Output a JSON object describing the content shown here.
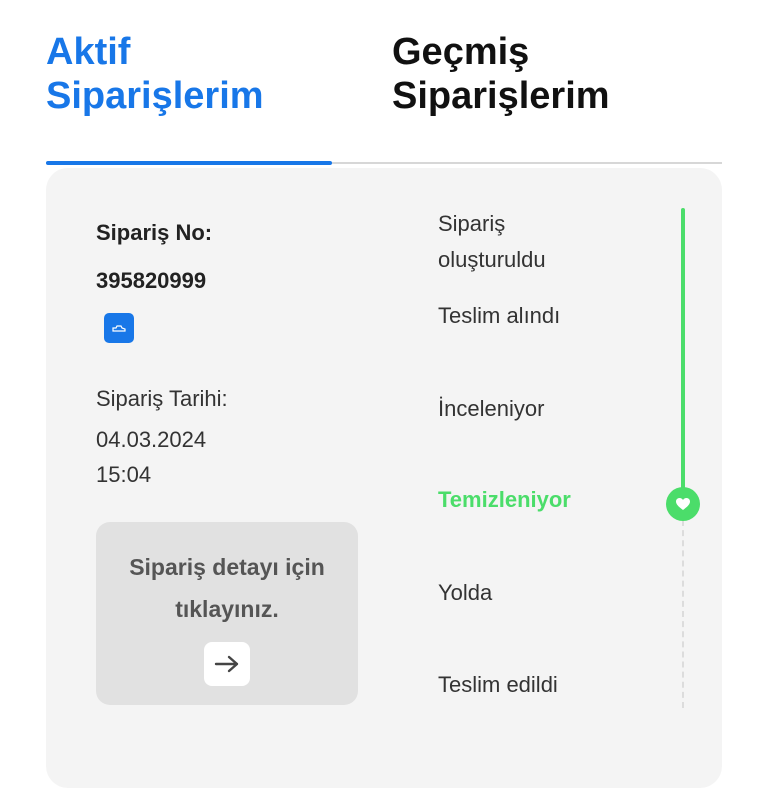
{
  "tabs": {
    "active": "Aktif Siparişlerim",
    "inactive": "Geçmiş Siparişlerim"
  },
  "order": {
    "number_label": "Sipariş No:",
    "number_value": "395820999",
    "date_label": "Sipariş Tarihi:",
    "date_value": "04.03.2024",
    "time_value": "15:04",
    "detail_button": "Sipariş detayı için tıklayınız."
  },
  "timeline": {
    "steps": [
      {
        "label": "Sipariş oluşturuldu",
        "state": "done"
      },
      {
        "label": "Teslim alındı",
        "state": "done"
      },
      {
        "label": "İnceleniyor",
        "state": "done"
      },
      {
        "label": "Temizleniyor",
        "state": "current"
      },
      {
        "label": "Yolda",
        "state": "pending"
      },
      {
        "label": "Teslim edildi",
        "state": "pending"
      }
    ]
  },
  "colors": {
    "accent": "#1877e8",
    "success": "#4bdd6a",
    "card_bg": "#f4f4f4",
    "button_bg": "#e1e1e1"
  },
  "icons": {
    "copy": "copy-icon",
    "arrow": "arrow-right-icon",
    "check": "check-icon"
  }
}
